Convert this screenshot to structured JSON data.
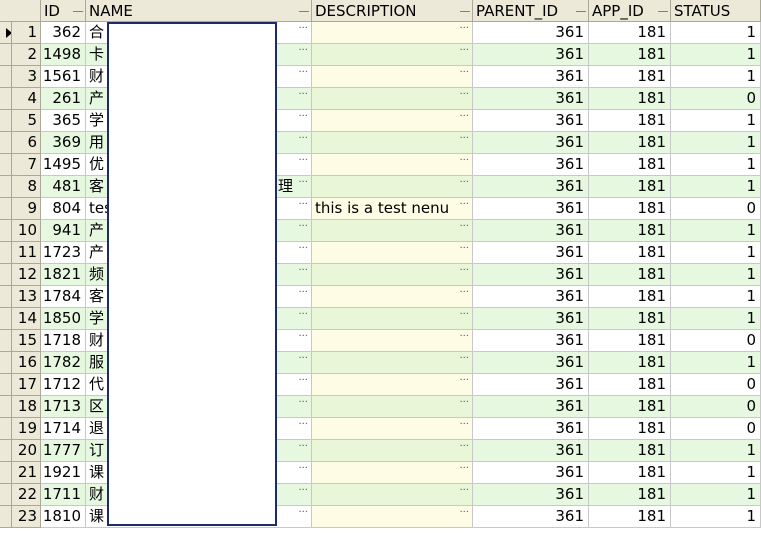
{
  "headers": {
    "id": "ID",
    "name": "NAME",
    "description": "DESCRIPTION",
    "parent_id": "PARENT_ID",
    "app_id": "APP_ID",
    "status": "STATUS"
  },
  "ellipsis": "···",
  "rows": [
    {
      "n": "1",
      "id": "362",
      "name": "合",
      "desc": "",
      "parent": "361",
      "app": "181",
      "status": "1"
    },
    {
      "n": "2",
      "id": "1498",
      "name": "卡",
      "desc": "",
      "parent": "361",
      "app": "181",
      "status": "1"
    },
    {
      "n": "3",
      "id": "1561",
      "name": "财",
      "desc": "",
      "parent": "361",
      "app": "181",
      "status": "1"
    },
    {
      "n": "4",
      "id": "261",
      "name": "产",
      "desc": "",
      "parent": "361",
      "app": "181",
      "status": "0"
    },
    {
      "n": "5",
      "id": "365",
      "name": "学",
      "desc": "",
      "parent": "361",
      "app": "181",
      "status": "1"
    },
    {
      "n": "6",
      "id": "369",
      "name": "用",
      "desc": "",
      "parent": "361",
      "app": "181",
      "status": "1"
    },
    {
      "n": "7",
      "id": "1495",
      "name": "优",
      "desc": "",
      "parent": "361",
      "app": "181",
      "status": "1"
    },
    {
      "n": "8",
      "id": "481",
      "name": "客",
      "desc": "",
      "parent": "361",
      "app": "181",
      "status": "1",
      "name_tail": "理"
    },
    {
      "n": "9",
      "id": "804",
      "name": "tes",
      "desc": "this is  a test nenu",
      "parent": "361",
      "app": "181",
      "status": "0"
    },
    {
      "n": "10",
      "id": "941",
      "name": "产",
      "desc": "",
      "parent": "361",
      "app": "181",
      "status": "1"
    },
    {
      "n": "11",
      "id": "1723",
      "name": "产",
      "desc": "",
      "parent": "361",
      "app": "181",
      "status": "1"
    },
    {
      "n": "12",
      "id": "1821",
      "name": "频",
      "desc": "",
      "parent": "361",
      "app": "181",
      "status": "1"
    },
    {
      "n": "13",
      "id": "1784",
      "name": "客",
      "desc": "",
      "parent": "361",
      "app": "181",
      "status": "1"
    },
    {
      "n": "14",
      "id": "1850",
      "name": "学",
      "desc": "",
      "parent": "361",
      "app": "181",
      "status": "1"
    },
    {
      "n": "15",
      "id": "1718",
      "name": "财",
      "desc": "",
      "parent": "361",
      "app": "181",
      "status": "0"
    },
    {
      "n": "16",
      "id": "1782",
      "name": "服",
      "desc": "",
      "parent": "361",
      "app": "181",
      "status": "1"
    },
    {
      "n": "17",
      "id": "1712",
      "name": "代",
      "desc": "",
      "parent": "361",
      "app": "181",
      "status": "0"
    },
    {
      "n": "18",
      "id": "1713",
      "name": "区",
      "desc": "",
      "parent": "361",
      "app": "181",
      "status": "0"
    },
    {
      "n": "19",
      "id": "1714",
      "name": "退",
      "desc": "",
      "parent": "361",
      "app": "181",
      "status": "0"
    },
    {
      "n": "20",
      "id": "1777",
      "name": "订",
      "desc": "",
      "parent": "361",
      "app": "181",
      "status": "1"
    },
    {
      "n": "21",
      "id": "1921",
      "name": "课",
      "desc": "",
      "parent": "361",
      "app": "181",
      "status": "1"
    },
    {
      "n": "22",
      "id": "1711",
      "name": "财",
      "desc": "",
      "parent": "361",
      "app": "181",
      "status": "1"
    },
    {
      "n": "23",
      "id": "1810",
      "name": "课",
      "desc": "",
      "parent": "361",
      "app": "181",
      "status": "1"
    }
  ]
}
